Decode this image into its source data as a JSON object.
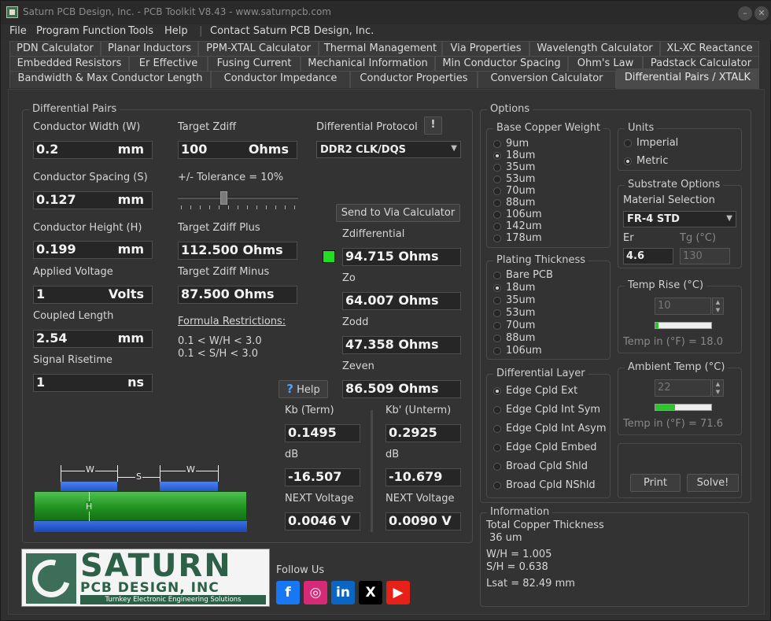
{
  "window": {
    "title": "Saturn PCB Design, Inc. - PCB Toolkit V8.43 - www.saturnpcb.com",
    "minimize_icon": "minimize-icon",
    "close_icon": "close-icon"
  },
  "menu": {
    "items": [
      "File",
      "Program Function",
      "Tools",
      "Help",
      "Contact Saturn PCB Design, Inc."
    ]
  },
  "tabs": {
    "row1": [
      "PDN Calculator",
      "Planar Inductors",
      "PPM-XTAL Calculator",
      "Thermal Management",
      "Via Properties",
      "Wavelength Calculator",
      "XL-XC Reactance"
    ],
    "row2": [
      "Embedded Resistors",
      "Er Effective",
      "Fusing Current",
      "Mechanical Information",
      "Min Conductor Spacing",
      "Ohm's Law",
      "Padstack Calculator"
    ],
    "row3": [
      "Bandwidth & Max Conductor Length",
      "Conductor Impedance",
      "Conductor Properties",
      "Conversion Calculator",
      "Differential Pairs / XTALK"
    ],
    "active": "Differential Pairs / XTALK"
  },
  "diff_pairs": {
    "title": "Differential Pairs",
    "conductor_width": {
      "label": "Conductor Width (W)",
      "value": "0.2",
      "unit": "mm"
    },
    "conductor_spacing": {
      "label": "Conductor Spacing (S)",
      "value": "0.127",
      "unit": "mm"
    },
    "conductor_height": {
      "label": "Conductor Height (H)",
      "value": "0.199",
      "unit": "mm"
    },
    "applied_voltage": {
      "label": "Applied Voltage",
      "value": "1",
      "unit": "Volts"
    },
    "coupled_length": {
      "label": "Coupled Length",
      "value": "2.54",
      "unit": "mm"
    },
    "signal_risetime": {
      "label": "Signal Risetime",
      "value": "1",
      "unit": "ns"
    },
    "target_zdiff": {
      "label": "Target Zdiff",
      "value": "100",
      "unit": "Ohms"
    },
    "tolerance": {
      "label": "+/- Tolerance = 10%",
      "value": 0.38
    },
    "target_plus": {
      "label": "Target Zdiff Plus",
      "value": "112.500 Ohms"
    },
    "target_minus": {
      "label": "Target Zdiff Minus",
      "value": "87.500 Ohms"
    },
    "formula_title": "Formula Restrictions:",
    "formula_1": "0.1 < W/H < 3.0",
    "formula_2": "0.1 < S/H < 3.0",
    "protocol_label": "Differential Protocol",
    "protocol_alert": "!",
    "protocol_value": "DDR2 CLK/DQS",
    "send_via_label": "Send to Via Calculator",
    "zdiff": {
      "label": "Zdifferential",
      "value": "94.715 Ohms",
      "status_color": "#22dd22"
    },
    "zo": {
      "label": "Zo",
      "value": "64.007 Ohms"
    },
    "zodd": {
      "label": "Zodd",
      "value": "47.358 Ohms"
    },
    "zeven": {
      "label": "Zeven",
      "value": "86.509 Ohms"
    },
    "help_label": "Help",
    "help_icon": "help-question-icon",
    "kb_term": {
      "label": "Kb (Term)",
      "value": "0.1495",
      "db_label": "dB",
      "db_value": "-16.507",
      "next_label": "NEXT Voltage",
      "next_value": "0.0046 V"
    },
    "kb_unterm": {
      "label": "Kb' (Unterm)",
      "value": "0.2925",
      "db_label": "dB",
      "db_value": "-10.679",
      "next_label": "NEXT Voltage",
      "next_value": "0.0090 V"
    },
    "diagram": {
      "w_label": "W",
      "s_label": "S",
      "h_label": "H"
    }
  },
  "options": {
    "title": "Options",
    "base_copper": {
      "title": "Base Copper Weight",
      "items": [
        "9um",
        "18um",
        "35um",
        "53um",
        "70um",
        "88um",
        "106um",
        "142um",
        "178um"
      ],
      "selected": 1
    },
    "units": {
      "title": "Units",
      "items": [
        "Imperial",
        "Metric"
      ],
      "selected": 1
    },
    "substrate": {
      "title": "Substrate Options",
      "material_label": "Material Selection",
      "material_value": "FR-4 STD",
      "er_label": "Er",
      "er_value": "4.6",
      "tg_label": "Tg (°C)",
      "tg_value": "130"
    },
    "plating": {
      "title": "Plating Thickness",
      "items": [
        "Bare PCB",
        "18um",
        "35um",
        "53um",
        "70um",
        "88um",
        "106um"
      ],
      "selected": 1
    },
    "temp_rise": {
      "title": "Temp Rise (°C)",
      "value": "10",
      "level": 0.05,
      "fahrenheit": "Temp in (°F) = 18.0"
    },
    "diff_layer": {
      "title": "Differential Layer",
      "items": [
        "Edge Cpld Ext",
        "Edge Cpld Int Sym",
        "Edge Cpld Int Asym",
        "Edge Cpld Embed",
        "Broad Cpld Shld",
        "Broad Cpld NShld"
      ],
      "selected": 0
    },
    "ambient_temp": {
      "title": "Ambient Temp (°C)",
      "value": "22",
      "level": 0.35,
      "fahrenheit": "Temp in (°F) = 71.6"
    },
    "print_label": "Print",
    "solve_label": "Solve!"
  },
  "information": {
    "title": "Information",
    "copper_label": "Total Copper Thickness",
    "copper_value": "36 um",
    "wh": "W/H =  1.005",
    "sh": "S/H =  0.638",
    "lsat": "Lsat =  82.49 mm"
  },
  "branding": {
    "logo_main": "SATURN",
    "logo_sub": "PCB DESIGN, INC",
    "logo_tag": "Turnkey Electronic Engineering Solutions",
    "follow_label": "Follow Us",
    "social": [
      {
        "icon": "facebook-icon",
        "glyph": "f",
        "color": "#1877f2"
      },
      {
        "icon": "instagram-icon",
        "glyph": "◎",
        "color": "#d62976"
      },
      {
        "icon": "linkedin-icon",
        "glyph": "in",
        "color": "#0a66c2"
      },
      {
        "icon": "x-icon",
        "glyph": "X",
        "color": "#000000"
      },
      {
        "icon": "youtube-icon",
        "glyph": "▶",
        "color": "#e62117"
      }
    ]
  }
}
